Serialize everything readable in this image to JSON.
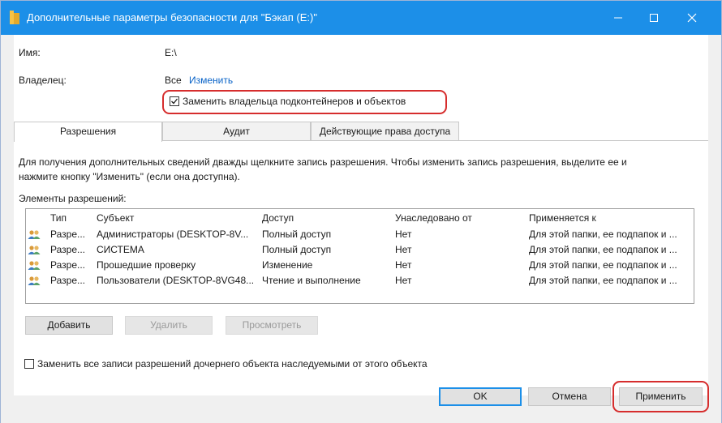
{
  "window": {
    "title": "Дополнительные параметры безопасности  для \"Бэкап (E:)\"",
    "controls": {
      "minimize": "minimize-icon",
      "maximize": "maximize-icon",
      "close": "close-icon"
    }
  },
  "info": {
    "name_label": "Имя:",
    "name_value": "E:\\",
    "owner_label": "Владелец:",
    "owner_value": "Все",
    "owner_change_link": "Изменить",
    "replace_owner_checkbox": {
      "label": "Заменить владельца подконтейнеров и объектов",
      "checked": true
    }
  },
  "tabs": [
    {
      "label": "Разрешения",
      "active": true
    },
    {
      "label": "Аудит",
      "active": false
    },
    {
      "label": "Действующие права доступа",
      "active": false
    }
  ],
  "permissions": {
    "description_line1": "Для получения дополнительных сведений дважды щелкните запись разрешения. Чтобы изменить запись разрешения, выделите ее и",
    "description_line2": "нажмите кнопку \"Изменить\" (если она доступна).",
    "entries_label": "Элементы разрешений:",
    "columns": [
      "Тип",
      "Субъект",
      "Доступ",
      "Унаследовано от",
      "Применяется к"
    ],
    "rows": [
      {
        "type": "Разре...",
        "subject": "Администраторы (DESKTOP-8V...",
        "access": "Полный доступ",
        "inherited": "Нет",
        "applies": "Для этой папки, ее подпапок и ..."
      },
      {
        "type": "Разре...",
        "subject": "СИСТЕМА",
        "access": "Полный доступ",
        "inherited": "Нет",
        "applies": "Для этой папки, ее подпапок и ..."
      },
      {
        "type": "Разре...",
        "subject": "Прошедшие проверку",
        "access": "Изменение",
        "inherited": "Нет",
        "applies": "Для этой папки, ее подпапок и ..."
      },
      {
        "type": "Разре...",
        "subject": "Пользователи (DESKTOP-8VG48...",
        "access": "Чтение и выполнение",
        "inherited": "Нет",
        "applies": "Для этой папки, ее подпапок и ..."
      }
    ],
    "add_button": "Добавить",
    "remove_button": "Удалить",
    "view_button": "Просмотреть",
    "replace_all_checkbox": {
      "label": "Заменить все записи разрешений дочернего объекта наследуемыми от этого объекта",
      "checked": false
    }
  },
  "footer": {
    "ok_button": "OK",
    "cancel_button": "Отмена",
    "apply_button": "Применить"
  },
  "colors": {
    "titlebar": "#1c8fe8",
    "highlight": "#d62d2d",
    "link": "#0a64c8"
  }
}
